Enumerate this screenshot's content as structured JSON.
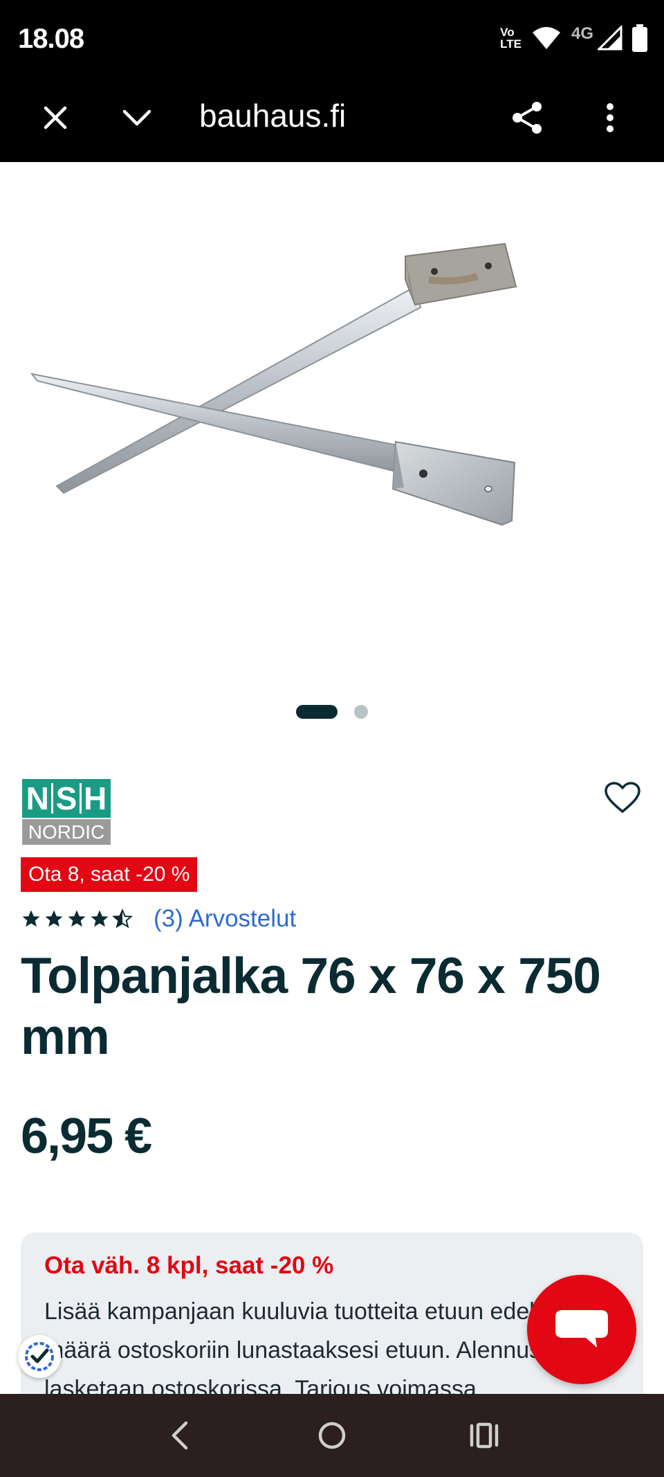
{
  "status_bar": {
    "time": "18.08",
    "volte_line1": "Vo",
    "volte_line2": "LTE",
    "network": "4G",
    "icons": [
      "volte-icon",
      "wifi-icon",
      "signal-icon",
      "battery-icon"
    ]
  },
  "toolbar": {
    "url": "bauhaus.fi",
    "icons": [
      "close-icon",
      "chevron-down-icon",
      "share-icon",
      "more-vertical-icon"
    ]
  },
  "gallery": {
    "slide_count": 2,
    "active_slide": 1
  },
  "brand": {
    "logo_letters": [
      "N",
      "S",
      "H"
    ],
    "logo_sub": "NORDIC",
    "logo_color": "#1a9b84"
  },
  "promo_badge": "Ota 8, saat -20 %",
  "rating": {
    "stars": 4.5,
    "max": 5,
    "reviews_label": "(3) Arvostelut"
  },
  "product": {
    "title": "Tolpanjalka 76 x 76 x 750 mm",
    "price": "6,95 €"
  },
  "promo_card": {
    "title": "Ota väh. 8 kpl, saat -20 %",
    "text": "Lisää kampanjaan kuuluvia tuotteita etuun edellytettävä määrä ostoskoriin lunastaaksesi etuun. Alennus lasketaan ostoskorissa. Tarjous voimassa"
  },
  "colors": {
    "accent_red": "#e30613",
    "text_dark": "#0b2b33",
    "link_blue": "#2d6bd0",
    "nav_bg": "#2b1f1f"
  },
  "nav": {
    "icons": [
      "back-icon",
      "home-icon",
      "recents-icon"
    ]
  }
}
